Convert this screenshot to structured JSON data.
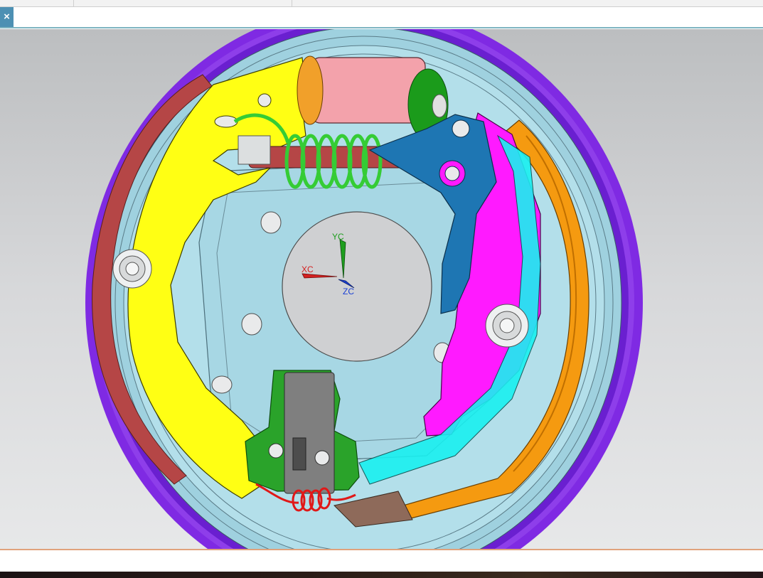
{
  "command_bar": {
    "close_label": "×",
    "input_value": ""
  },
  "viewport": {
    "triad": {
      "x_label": "XC",
      "y_label": "YC",
      "z_label": "ZC"
    }
  },
  "colors": {
    "backing_plate": "#a7d7e4",
    "drum_rim": "#7f2ae3",
    "leading_shoe": "#ffff14",
    "trailing_shoe_web": "#ff1aff",
    "trailing_shoe_lining": "#f59a10",
    "wheel_cylinder": "#f3a2ab",
    "adjuster_lever": "#1e76b3",
    "return_spring": "#35cc35",
    "adjuster_body": "#2aa32a",
    "lower_spring": "#e01818",
    "hub_center": "#cfd0d2",
    "x_axis": "#d42020",
    "y_axis": "#1e9e1e",
    "z_axis": "#1a3fd4"
  },
  "icons": [
    "close-icon",
    "coordinate-triad-icon"
  ]
}
